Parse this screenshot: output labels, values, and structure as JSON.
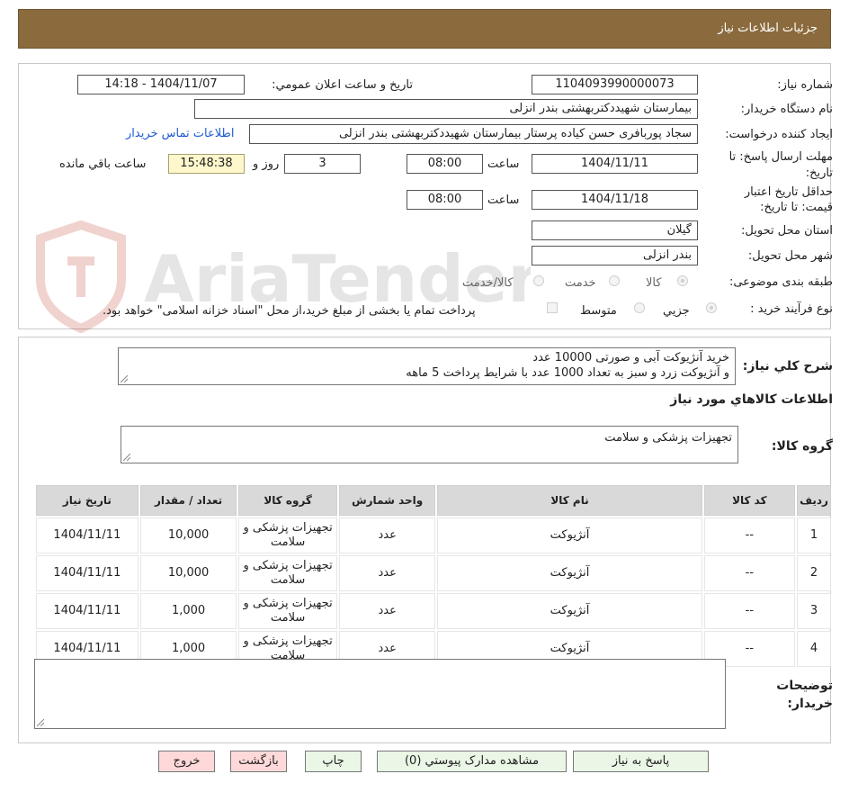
{
  "header": {
    "title": "جزئیات اطلاعات نیاز"
  },
  "watermark": {
    "text": "AriaTender.neT"
  },
  "form": {
    "need_number_label": "شماره نیاز:",
    "need_number": "1104093990000073",
    "announce_label": "تاریخ و ساعت اعلان عمومي:",
    "announce_value": "1404/11/07 - 14:18",
    "buyer_label": "نام دستگاه خريدار:",
    "buyer_value": "بیمارستان شهیددکتربهشتی بندر انزلی",
    "creator_label": "ايجاد کننده درخواست:",
    "creator_value": "سجاد پوربافری حسن کیاده پرستار بیمارستان شهیددکتربهشتی بندر انزلی",
    "contact_link": "اطلاعات تماس خريدار",
    "deadline_label": "مهلت ارسال پاسخ: تا تاريخ:",
    "deadline_date": "1404/11/11",
    "time_label": "ساعت",
    "deadline_time": "08:00",
    "days_value": "3",
    "days_label": "روز و",
    "remaining_time": "15:48:38",
    "remaining_label": "ساعت باقي مانده",
    "validity_label": "حداقل تاريخ اعتبار قيمت: تا تاريخ:",
    "validity_date": "1404/11/18",
    "validity_time": "08:00",
    "province_label": "استان محل تحويل:",
    "province_value": "گیلان",
    "city_label": "شهر محل تحويل:",
    "city_value": "بندر انزلی",
    "category_label": "طبقه بندی موضوعی:",
    "category_options": [
      "کالا",
      "خدمت",
      "کالا/خدمت"
    ],
    "purchase_label": "نوع فرآيند خريد :",
    "purchase_options": [
      "جزيي",
      "متوسط"
    ],
    "payment_note": "پرداخت تمام یا بخشی از مبلغ خرید،از محل \"اسناد خزانه اسلامی\" خواهد بود."
  },
  "summary": {
    "desc_label": "شرح کلي نياز:",
    "desc_line1": "خرید آنژیوکت آبی و صورتی 10000 عدد",
    "desc_line2": "و آنژیوکت زرد و سبز به تعداد  1000 عدد با شرایط پرداخت 5 ماهه",
    "goods_info_title": "اطلاعات کالاهاي مورد نياز",
    "group_label": "گروه کالا:",
    "group_value": "تجهیزات پزشکی و سلامت"
  },
  "table": {
    "headers": [
      "رديف",
      "کد کالا",
      "نام کالا",
      "واحد شمارش",
      "گروه کالا",
      "تعداد / مقدار",
      "تاريخ نياز"
    ],
    "rows": [
      [
        "1",
        "--",
        "آنژیوکت",
        "عدد",
        "تجهیزات پزشکی و سلامت",
        "10,000",
        "1404/11/11"
      ],
      [
        "2",
        "--",
        "آنژیوکت",
        "عدد",
        "تجهیزات پزشکی و سلامت",
        "10,000",
        "1404/11/11"
      ],
      [
        "3",
        "--",
        "آنژیوکت",
        "عدد",
        "تجهیزات پزشکی و سلامت",
        "1,000",
        "1404/11/11"
      ],
      [
        "4",
        "--",
        "آنژیوکت",
        "عدد",
        "تجهیزات پزشکی و سلامت",
        "1,000",
        "1404/11/11"
      ]
    ]
  },
  "notes": {
    "label": "توضيحات خريدار:"
  },
  "buttons": {
    "reply": "پاسخ به نياز",
    "attachments": "مشاهده مدارک پيوستي (0)",
    "print": "چاپ",
    "back": "بازگشت",
    "exit": "خروج"
  },
  "colors": {
    "header_bg": "#8b6b3d",
    "link": "#1e5bd6",
    "button_green": "#eaf6e6",
    "button_pink": "#ffd9d9",
    "remaining_bg": "#fff7cc"
  }
}
